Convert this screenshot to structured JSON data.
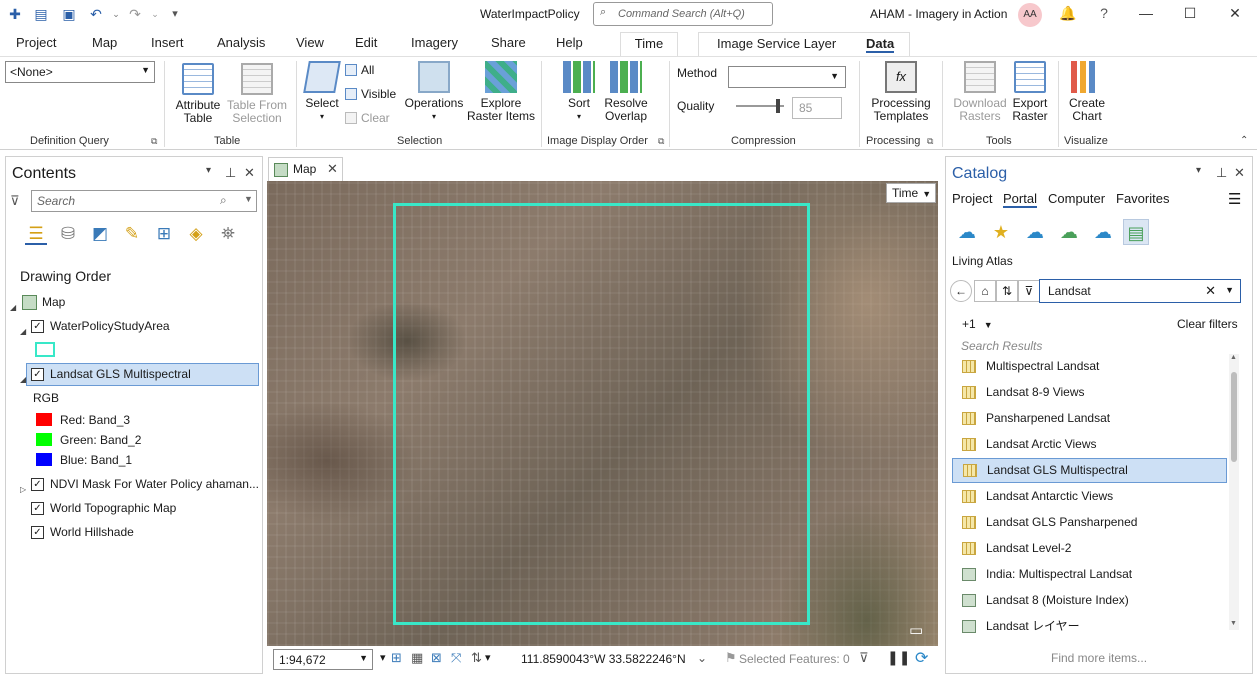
{
  "titlebar": {
    "document_title": "WaterImpactPolicy",
    "command_search_placeholder": "Command Search (Alt+Q)",
    "user_label": "AHAM - Imagery in Action",
    "avatar_initials": "AA"
  },
  "ribbon_tabs": [
    "Project",
    "Map",
    "Insert",
    "Analysis",
    "View",
    "Edit",
    "Imagery",
    "Share",
    "Help",
    "Time",
    "Image Service Layer",
    "Data"
  ],
  "ribbon": {
    "definition_query": {
      "value": "<None>",
      "group": "Definition Query"
    },
    "table": {
      "attribute_table": "Attribute\nTable",
      "table_from_selection": "Table From\nSelection",
      "group": "Table"
    },
    "selection": {
      "select": "Select",
      "all": "All",
      "visible": "Visible",
      "clear": "Clear",
      "operations": "Operations",
      "explore": "Explore\nRaster Items",
      "group": "Selection"
    },
    "image_display_order": {
      "sort": "Sort",
      "resolve_overlap": "Resolve\nOverlap",
      "group": "Image Display Order"
    },
    "compression": {
      "method_label": "Method",
      "quality_label": "Quality",
      "quality_value": "85",
      "group": "Compression"
    },
    "processing": {
      "templates": "Processing\nTemplates",
      "group": "Processing"
    },
    "tools": {
      "download_rasters": "Download\nRasters",
      "export_raster": "Export\nRaster",
      "group": "Tools"
    },
    "visualize": {
      "create_chart": "Create\nChart",
      "group": "Visualize"
    }
  },
  "contents": {
    "title": "Contents",
    "search_placeholder": "Search",
    "section": "Drawing Order",
    "map_label": "Map",
    "layers": {
      "water_policy": "WaterPolicyStudyArea",
      "landsat_gls": "Landsat GLS Multispectral",
      "rgb": "RGB",
      "red": "Red:   Band_3",
      "green": "Green: Band_2",
      "blue": "Blue:  Band_1",
      "ndvi": "NDVI Mask For Water Policy ahaman...",
      "topo": "World Topographic Map",
      "hillshade": "World Hillshade"
    },
    "colors": {
      "study_outline": "#38e8c8",
      "red": "#ff0000",
      "green": "#00ff00",
      "blue": "#0000ff"
    }
  },
  "map": {
    "tab_label": "Map",
    "time_button": "Time",
    "scale": "1:94,672",
    "coordinates": "111.8590043°W 33.5822246°N",
    "selected_features": "Selected Features: 0"
  },
  "catalog": {
    "title": "Catalog",
    "tabs": [
      "Project",
      "Portal",
      "Computer",
      "Favorites"
    ],
    "living_atlas": "Living Atlas",
    "search_value": "Landsat",
    "result_count": "+1",
    "clear_filters": "Clear filters",
    "search_results_label": "Search Results",
    "results": [
      "Multispectral Landsat",
      "Landsat 8-9 Views",
      "Pansharpened Landsat",
      "Landsat Arctic Views",
      "Landsat GLS Multispectral",
      "Landsat Antarctic Views",
      "Landsat GLS Pansharpened",
      "Landsat Level-2",
      "India: Multispectral Landsat",
      "Landsat 8 (Moisture Index)",
      "Landsat レイヤー"
    ],
    "find_more": "Find more items..."
  }
}
